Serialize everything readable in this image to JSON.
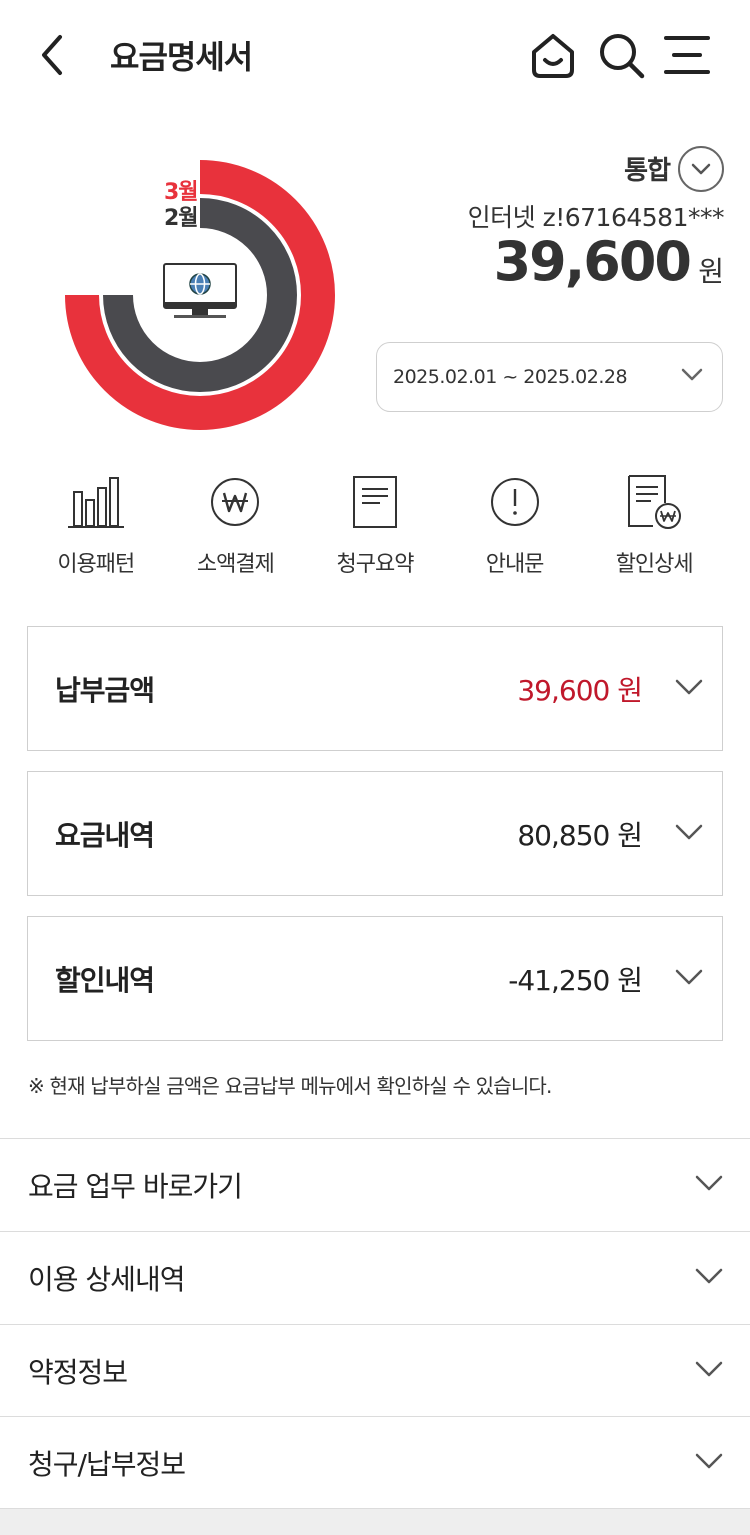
{
  "header": {
    "title": "요금명세서",
    "icons": [
      "back-icon",
      "home-icon",
      "search-icon",
      "menu-icon"
    ]
  },
  "summary": {
    "chart_months": [
      "3월",
      "2월"
    ],
    "service_type": "통합",
    "account": "인터넷 z!67164581***",
    "total_amount": "39,600",
    "unit": "원",
    "period": "2025.02.01 ~ 2025.02.28",
    "colors": {
      "current": "#e8323c",
      "previous": "#4a4a4e"
    }
  },
  "quick_menu": [
    {
      "label": "이용패턴",
      "icon": "bar-chart-icon"
    },
    {
      "label": "소액결제",
      "icon": "won-circle-icon"
    },
    {
      "label": "청구요약",
      "icon": "document-icon"
    },
    {
      "label": "안내문",
      "icon": "info-circle-icon"
    },
    {
      "label": "할인상세",
      "icon": "discount-document-icon"
    }
  ],
  "cards": [
    {
      "title": "납부금액",
      "amount": "39,600 원",
      "accent": "#c0182b"
    },
    {
      "title": "요금내역",
      "amount": "80,850 원"
    },
    {
      "title": "할인내역",
      "amount": "-41,250 원"
    }
  ],
  "notice": "※ 현재 납부하실 금액은 요금납부 메뉴에서 확인하실 수 있습니다.",
  "sections": [
    {
      "label": "요금 업무 바로가기"
    },
    {
      "label": "이용 상세내역"
    },
    {
      "label": "약정정보"
    },
    {
      "label": "청구/납부정보"
    }
  ]
}
